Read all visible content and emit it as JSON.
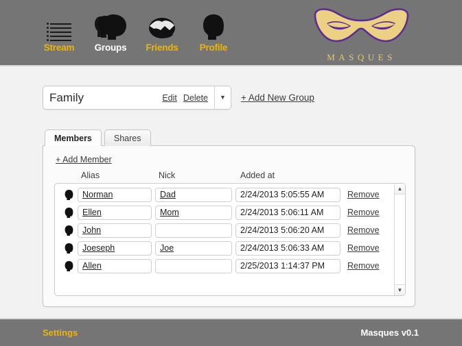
{
  "header": {
    "nav": [
      {
        "label": "Stream",
        "icon": "stream-list-icon",
        "active": false
      },
      {
        "label": "Groups",
        "icon": "group-heads-icon",
        "active": true
      },
      {
        "label": "Friends",
        "icon": "handshake-icon",
        "active": false
      },
      {
        "label": "Profile",
        "icon": "single-head-icon",
        "active": false
      }
    ],
    "logo": {
      "icon": "masquerade-mask-icon",
      "wordmark": "MASQUES"
    }
  },
  "group_bar": {
    "selected_group": "Family",
    "edit_label": "Edit",
    "delete_label": "Delete",
    "caret_glyph": "▼",
    "add_new_group_label": "+ Add New Group"
  },
  "tabs": [
    {
      "label": "Members",
      "active": true
    },
    {
      "label": "Shares",
      "active": false
    }
  ],
  "members_panel": {
    "add_member_label": "+ Add Member",
    "columns": {
      "alias": "Alias",
      "nick": "Nick",
      "added_at": "Added at"
    },
    "remove_label": "Remove",
    "rows": [
      {
        "avatar": "head-silhouette-icon",
        "alias": "Norman",
        "nick": "Dad",
        "added_at": "2/24/2013 5:05:55 AM"
      },
      {
        "avatar": "head-silhouette-icon",
        "alias": "Ellen",
        "nick": "Mom",
        "added_at": "2/24/2013 5:06:11 AM"
      },
      {
        "avatar": "head-silhouette-icon",
        "alias": "John",
        "nick": "",
        "added_at": "2/24/2013 5:06:20 AM"
      },
      {
        "avatar": "head-silhouette-icon",
        "alias": "Joeseph",
        "nick": "Joe",
        "added_at": "2/24/2013 5:06:33 AM"
      },
      {
        "avatar": "head-silhouette-icon",
        "alias": "Allen",
        "nick": "",
        "added_at": "2/25/2013 1:14:37 PM"
      }
    ],
    "scrollbar": {
      "up_glyph": "▲",
      "down_glyph": "▼"
    }
  },
  "footer": {
    "settings_label": "Settings",
    "version_label": "Masques v0.1"
  },
  "colors": {
    "chrome_gray": "#757575",
    "accent_gold": "#f0b400",
    "logo_gold": "#ecd184",
    "logo_purple": "#5b2d8e",
    "page_bg": "#f2f2f2"
  }
}
